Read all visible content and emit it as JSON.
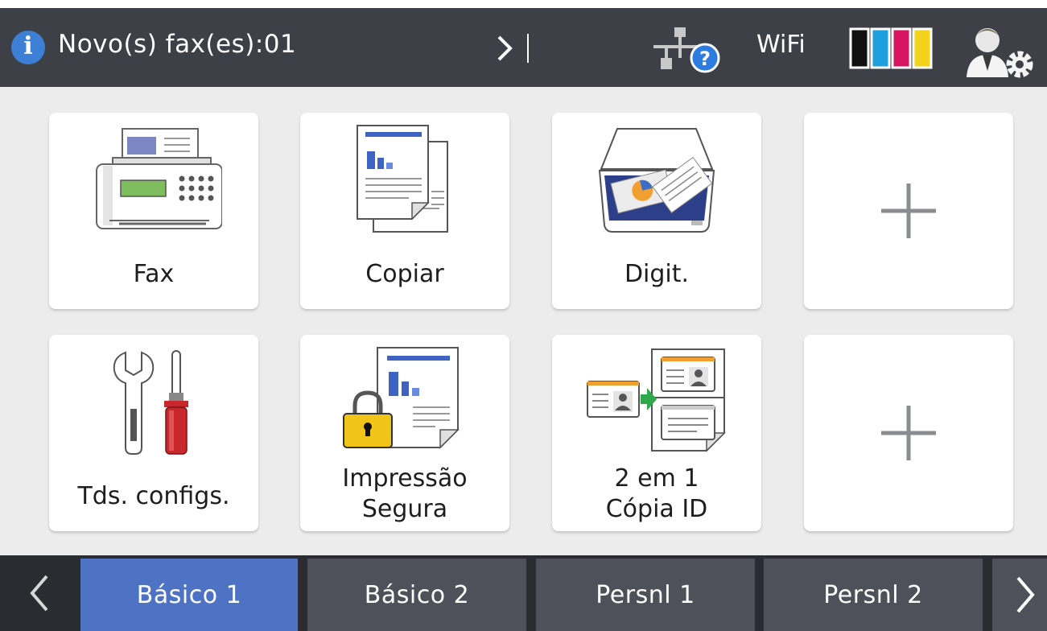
{
  "status_bar": {
    "notice": "Novo(s) fax(es):01",
    "wifi_label": "WiFi",
    "ink_colors": [
      "#111111",
      "#1e9fe0",
      "#d6145f",
      "#f2d21a"
    ]
  },
  "tiles": [
    {
      "label": "Fax",
      "icon": "fax-machine-icon"
    },
    {
      "label": "Copiar",
      "icon": "copy-documents-icon"
    },
    {
      "label": "Digit.",
      "icon": "scanner-icon"
    },
    {
      "label": "",
      "icon": "plus-icon"
    },
    {
      "label": "Tds. configs.",
      "icon": "tools-icon"
    },
    {
      "label_line1": "Impressão",
      "label_line2": "Segura",
      "icon": "secure-print-icon"
    },
    {
      "label_line1": "2 em 1",
      "label_line2": "Cópia ID",
      "icon": "id-copy-icon"
    },
    {
      "label": "",
      "icon": "plus-icon"
    }
  ],
  "tabs": [
    {
      "label": "Básico 1",
      "active": true
    },
    {
      "label": "Básico 2",
      "active": false
    },
    {
      "label": "Persnl 1",
      "active": false
    },
    {
      "label": "Persnl 2",
      "active": false
    }
  ],
  "colors": {
    "status_bar_bg": "#3e4048",
    "tile_area_bg": "#ececec",
    "active_tab": "#4e72c4",
    "inactive_tab": "#4f515a"
  }
}
